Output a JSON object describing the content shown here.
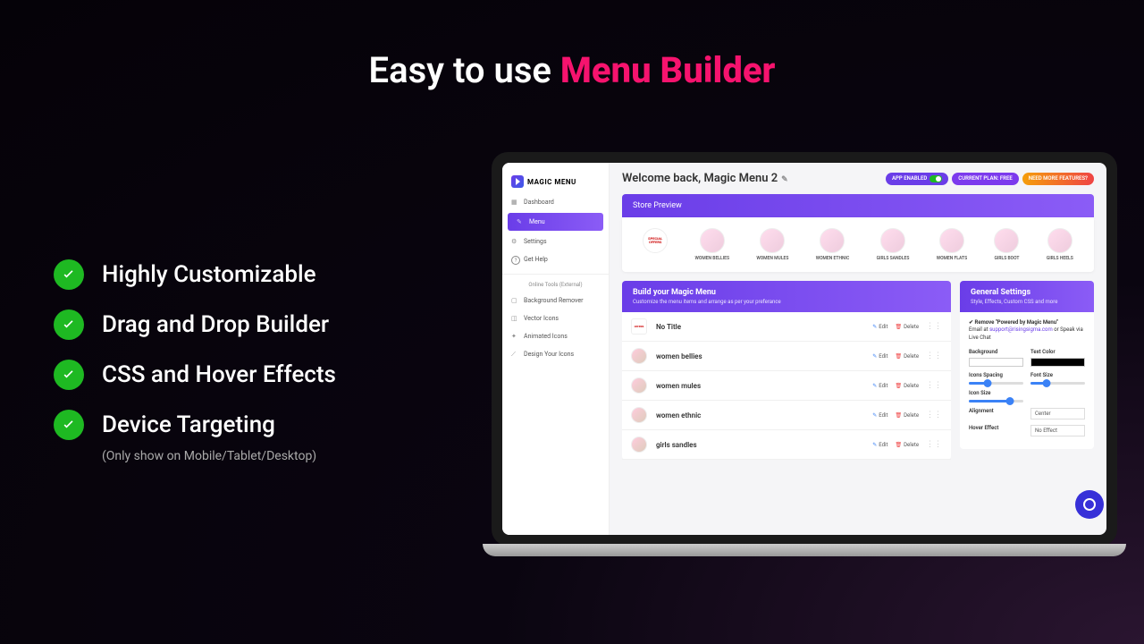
{
  "hero": {
    "prefix": "Easy to use ",
    "accent": "Menu Builder"
  },
  "features": [
    "Highly Customizable",
    "Drag and Drop Builder",
    "CSS and Hover Effects",
    "Device Targeting"
  ],
  "features_sub": "(Only show on Mobile/Tablet/Desktop)",
  "logo": "MAGIC MENU",
  "nav": {
    "items": [
      "Dashboard",
      "Menu",
      "Settings",
      "Get Help"
    ],
    "section": "Online Tools (External)",
    "tools": [
      "Background Remover",
      "Vector Icons",
      "Animated Icons",
      "Design Your Icons"
    ]
  },
  "welcome": "Welcome back, Magic Menu 2",
  "pills": {
    "enabled": "APP ENABLED",
    "plan": "CURRENT PLAN: FREE",
    "upgrade": "NEED MORE FEATURES?"
  },
  "preview": {
    "title": "Store Preview",
    "items": [
      "SPECIAL OFFERS",
      "WOMEN BELLIES",
      "WOMEN MULES",
      "WOMEN ETHNIC",
      "GIRLS SANDLES",
      "WOMEN FLATS",
      "GIRLS BOOT",
      "GIRLS HEELS"
    ]
  },
  "builder": {
    "title": "Build your Magic Menu",
    "sub": "Customize the menu items and arrange as per your preferance",
    "edit": "Edit",
    "delete": "Delete",
    "rows": [
      "No Title",
      "women bellies",
      "women mules",
      "women ethnic",
      "girls sandles"
    ]
  },
  "settings": {
    "title": "General Settings",
    "sub": "Style, Effects, Custom CSS and more",
    "note_pre": "✔ Remove \"Powered by Magic Menu\"",
    "note": "Email at ",
    "note_email": "support@risingsigma.com",
    "note_post": " or Speak via Live Chat",
    "bg": "Background",
    "tc": "Text Color",
    "spacing": "Icons Spacing",
    "fsize": "Font Size",
    "isize": "Icon Size",
    "align": "Alignment",
    "align_v": "Center",
    "hover": "Hover Effect",
    "hover_v": "No Effect"
  }
}
